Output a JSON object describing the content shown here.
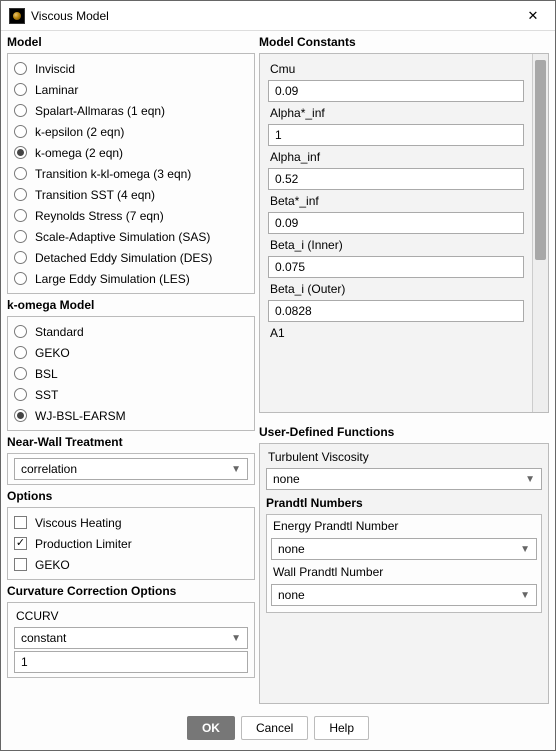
{
  "title": "Viscous Model",
  "left": {
    "model_label": "Model",
    "models": [
      "Inviscid",
      "Laminar",
      "Spalart-Allmaras (1 eqn)",
      "k-epsilon (2 eqn)",
      "k-omega (2 eqn)",
      "Transition k-kl-omega (3 eqn)",
      "Transition SST (4 eqn)",
      "Reynolds Stress (7 eqn)",
      "Scale-Adaptive Simulation (SAS)",
      "Detached Eddy Simulation (DES)",
      "Large Eddy Simulation (LES)"
    ],
    "model_selected": "k-omega (2 eqn)",
    "komega_label": "k-omega Model",
    "komega_options": [
      "Standard",
      "GEKO",
      "BSL",
      "SST",
      "WJ-BSL-EARSM"
    ],
    "komega_selected": "WJ-BSL-EARSM",
    "nearwall_label": "Near-Wall Treatment",
    "nearwall_value": "correlation",
    "options_label": "Options",
    "options": [
      {
        "label": "Viscous Heating",
        "checked": false
      },
      {
        "label": "Production Limiter",
        "checked": true
      },
      {
        "label": "GEKO",
        "checked": false
      }
    ],
    "curvature_label": "Curvature Correction Options",
    "curvature_sub": "CCURV",
    "curvature_select": "constant",
    "curvature_value": "1"
  },
  "right": {
    "constants_label": "Model Constants",
    "constants": [
      {
        "label": "Cmu",
        "value": "0.09"
      },
      {
        "label": "Alpha*_inf",
        "value": "1"
      },
      {
        "label": "Alpha_inf",
        "value": "0.52"
      },
      {
        "label": "Beta*_inf",
        "value": "0.09"
      },
      {
        "label": "Beta_i (Inner)",
        "value": "0.075"
      },
      {
        "label": "Beta_i (Outer)",
        "value": "0.0828"
      }
    ],
    "constants_next_label": "A1",
    "udf_label": "User-Defined Functions",
    "udf_turb_label": "Turbulent Viscosity",
    "udf_turb_value": "none",
    "prandtl_label": "Prandtl Numbers",
    "prandtl_energy_label": "Energy Prandtl Number",
    "prandtl_energy_value": "none",
    "prandtl_wall_label": "Wall Prandtl Number",
    "prandtl_wall_value": "none"
  },
  "footer": {
    "ok": "OK",
    "cancel": "Cancel",
    "help": "Help"
  }
}
